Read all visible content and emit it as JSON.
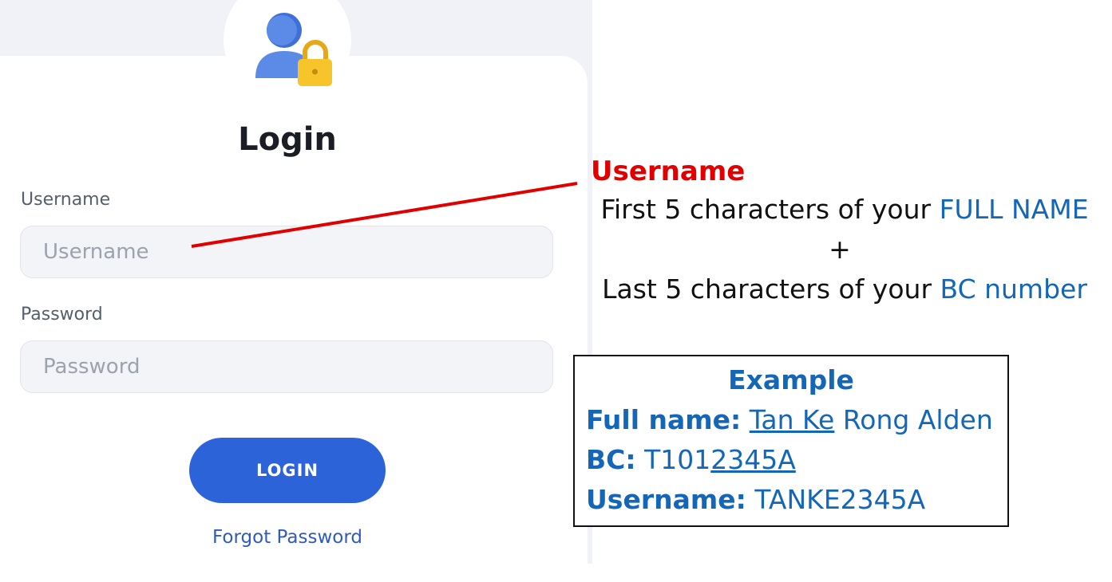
{
  "login": {
    "title": "Login",
    "username_label": "Username",
    "username_placeholder": "Username",
    "username_value": "",
    "password_label": "Password",
    "password_placeholder": "Password",
    "password_value": "",
    "login_button": "LOGIN",
    "forgot_link": "Forgot Password"
  },
  "annotation": {
    "title": "Username",
    "line1_text": "First 5 characters of your ",
    "line1_highlight": "FULL NAME",
    "plus": "+",
    "line2_text": "Last 5 characters of your ",
    "line2_highlight": "BC number"
  },
  "example": {
    "heading": "Example",
    "fullname_label": "Full name:",
    "fullname_underlined": "Tan Ke",
    "fullname_rest": " Rong Alden",
    "bc_label": "BC:",
    "bc_plain": "T101",
    "bc_underlined": "2345A",
    "username_label": "Username:",
    "username_value": "TANKE2345A"
  },
  "colors": {
    "accent_blue": "#2d63d9",
    "annotation_red": "#e00000",
    "highlight_blue": "#1466b6"
  },
  "icons": {
    "avatar": "user-lock-icon"
  }
}
